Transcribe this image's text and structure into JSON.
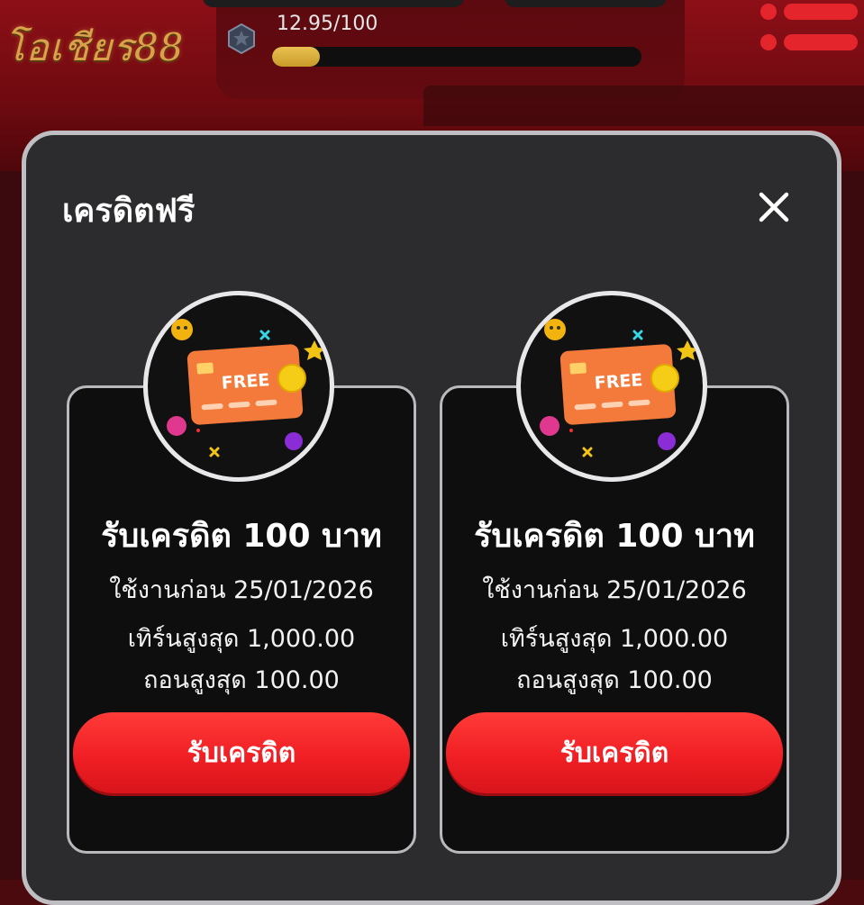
{
  "header": {
    "logo_text": "โอเชียร88",
    "rank_icon": "shield-star-icon",
    "progress_text": "12.95/100",
    "progress_value": 0.1295,
    "menu_icon": "hamburger-menu-icon"
  },
  "modal": {
    "title": "เครดิตฟรี",
    "close_icon": "close-icon",
    "cards": [
      {
        "icon": "free-credit-card-icon",
        "icon_label": "FREE",
        "title": "รับเครดิต 100 บาท",
        "expiry": "ใช้งานก่อน 25/01/2026",
        "max_turnover": "เทิร์นสูงสุด 1,000.00",
        "max_withdraw": "ถอนสูงสุด 100.00",
        "button_label": "รับเครดิต"
      },
      {
        "icon": "free-credit-card-icon",
        "icon_label": "FREE",
        "title": "รับเครดิต 100 บาท",
        "expiry": "ใช้งานก่อน 25/01/2026",
        "max_turnover": "เทิร์นสูงสุด 1,000.00",
        "max_withdraw": "ถอนสูงสุด 100.00",
        "button_label": "รับเครดิต"
      }
    ]
  },
  "colors": {
    "accent_red": "#e5252c",
    "button_red": "#f01f24",
    "progress_gold": "#e0b43e",
    "modal_bg": "#2c2c2e",
    "card_bg": "#0e0e0f"
  }
}
